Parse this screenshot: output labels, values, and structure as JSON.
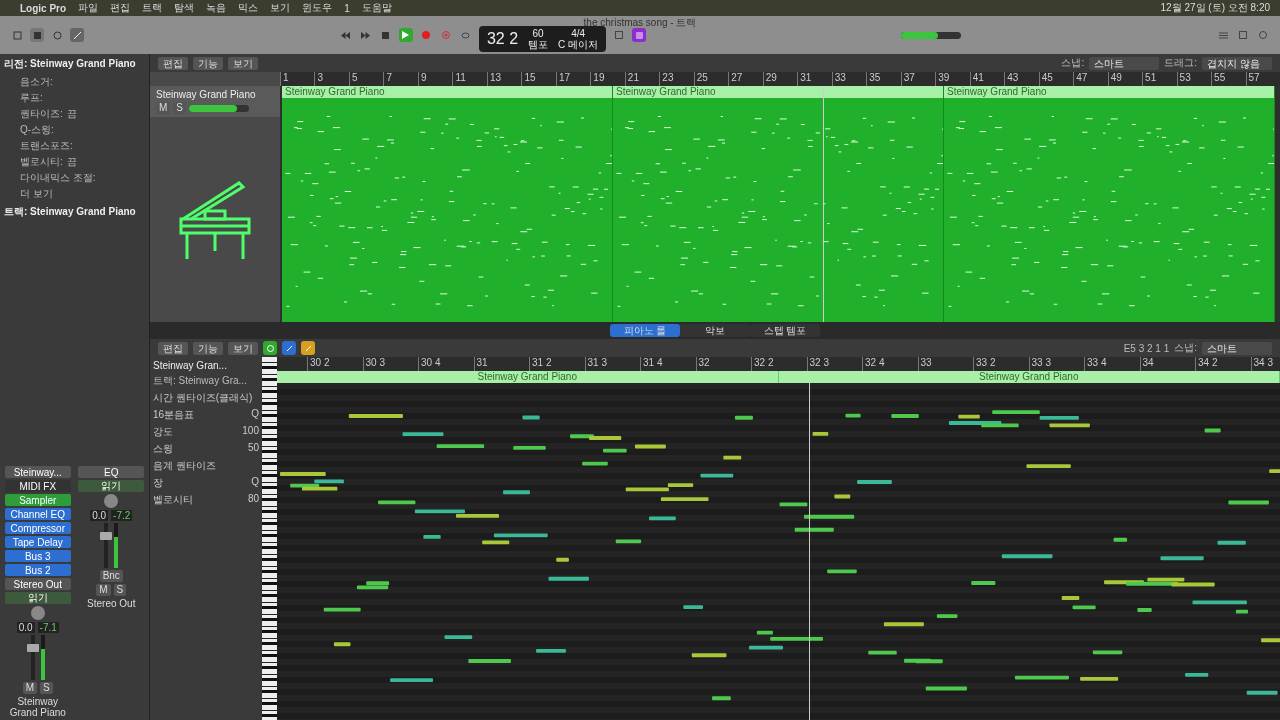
{
  "menu_bar": {
    "items": [
      "Logic Pro",
      "파일",
      "편집",
      "트랙",
      "탐색",
      "녹음",
      "믹스",
      "보기",
      "윈도우",
      "1",
      "도움말"
    ],
    "clock": "12월 27일 (토) 오전 8:20"
  },
  "window": {
    "title": "the christmas song - 트랙"
  },
  "transport": {
    "position": "32 2",
    "tempo": "60",
    "tempo_label": "템포",
    "signature": "4/4",
    "key": "C 메이저",
    "master_volume": {
      "level": 0.62
    }
  },
  "tracks_toolbar": {
    "menus": [
      "편집",
      "기능",
      "보기"
    ],
    "snap_label": "스냅:",
    "snap": "스마트",
    "drag_label": "드래그:",
    "drag": "겹치지 않음"
  },
  "ruler": [
    "1",
    "3",
    "5",
    "7",
    "9",
    "11",
    "13",
    "15",
    "17",
    "19",
    "21",
    "23",
    "25",
    "27",
    "29",
    "31",
    "33",
    "35",
    "37",
    "39",
    "41",
    "43",
    "45",
    "47",
    "49",
    "51",
    "53",
    "55",
    "57"
  ],
  "track": {
    "name": "Steinway Grand Piano",
    "mute": "M",
    "solo": "S",
    "volume": {
      "level": 0.8
    }
  },
  "regions": [
    "Steinway Grand Piano",
    "Steinway Grand Piano",
    "Steinway Grand Piano"
  ],
  "inspector": {
    "region_header": "리전: Steinway Grand Piano",
    "rows": [
      {
        "label": "음소거:"
      },
      {
        "label": "루프:"
      },
      {
        "label": "퀀타이즈:",
        "value": "끔"
      },
      {
        "label": "Q-스윙:"
      },
      {
        "label": "트랜스포즈:"
      },
      {
        "label": "벨로시티:",
        "value": "끔"
      },
      {
        "label": "다이내믹스 조절:"
      }
    ],
    "more": "더 보기",
    "track_header": "트랙: Steinway Grand Piano"
  },
  "channel_strips": [
    {
      "setting": "Steinway...",
      "midi_fx": "MIDI FX",
      "instrument": "Sampler",
      "plugins": [
        "Channel EQ",
        "Compressor",
        "Tape Delay"
      ],
      "sends": [
        "Bus 3",
        "Bus 2"
      ],
      "output": "Stereo Out",
      "automation": "읽기",
      "volume": "0.0",
      "peak": "-7.1",
      "fader": {
        "level": 0.75
      },
      "meter": {
        "level": 0.7
      },
      "buttons": [
        "M",
        "S"
      ],
      "name": "Steinway Grand Piano"
    },
    {
      "setting": "EQ",
      "automation": "읽기",
      "volume": "0.0",
      "peak": "-7.2",
      "fader": {
        "level": 0.75
      },
      "meter": {
        "level": 0.68
      },
      "buttons": [
        "M",
        "S"
      ],
      "bounce": "Bnc",
      "name": "Stereo Out"
    }
  ],
  "editor_tabs": [
    {
      "label": "피아노 롤",
      "selected": true
    },
    {
      "label": "악보",
      "selected": false
    },
    {
      "label": "스텝 템포",
      "selected": false
    }
  ],
  "piano_roll": {
    "menus": [
      "편집",
      "기능",
      "보기"
    ],
    "track_name": "Steinway Gran...",
    "track_sub": "트랙: Steinway Gra...",
    "position": "E5  3 2 1 1",
    "snap_label": "스냅:",
    "snap": "스마트",
    "params": [
      {
        "label": "시간 퀀타이즈(클래식)"
      },
      {
        "label": "16분음표",
        "value": "Q"
      },
      {
        "label": "강도",
        "value": "100"
      },
      {
        "label": "스윙",
        "value": "50"
      },
      {
        "label": "음계 퀀타이즈"
      },
      {
        "label": "장",
        "value": "Q"
      },
      {
        "label": "벨로시티",
        "value": "80"
      }
    ],
    "ruler": [
      "30 2",
      "30 3",
      "30 4",
      "31",
      "31 2",
      "31 3",
      "31 4",
      "32",
      "32 2",
      "32 3",
      "32 4",
      "33",
      "33 2",
      "33 3",
      "33 4",
      "34",
      "34 2",
      "34 3"
    ],
    "regions": [
      "Steinway Grand Piano",
      "Steinway Grand Piano"
    ]
  }
}
